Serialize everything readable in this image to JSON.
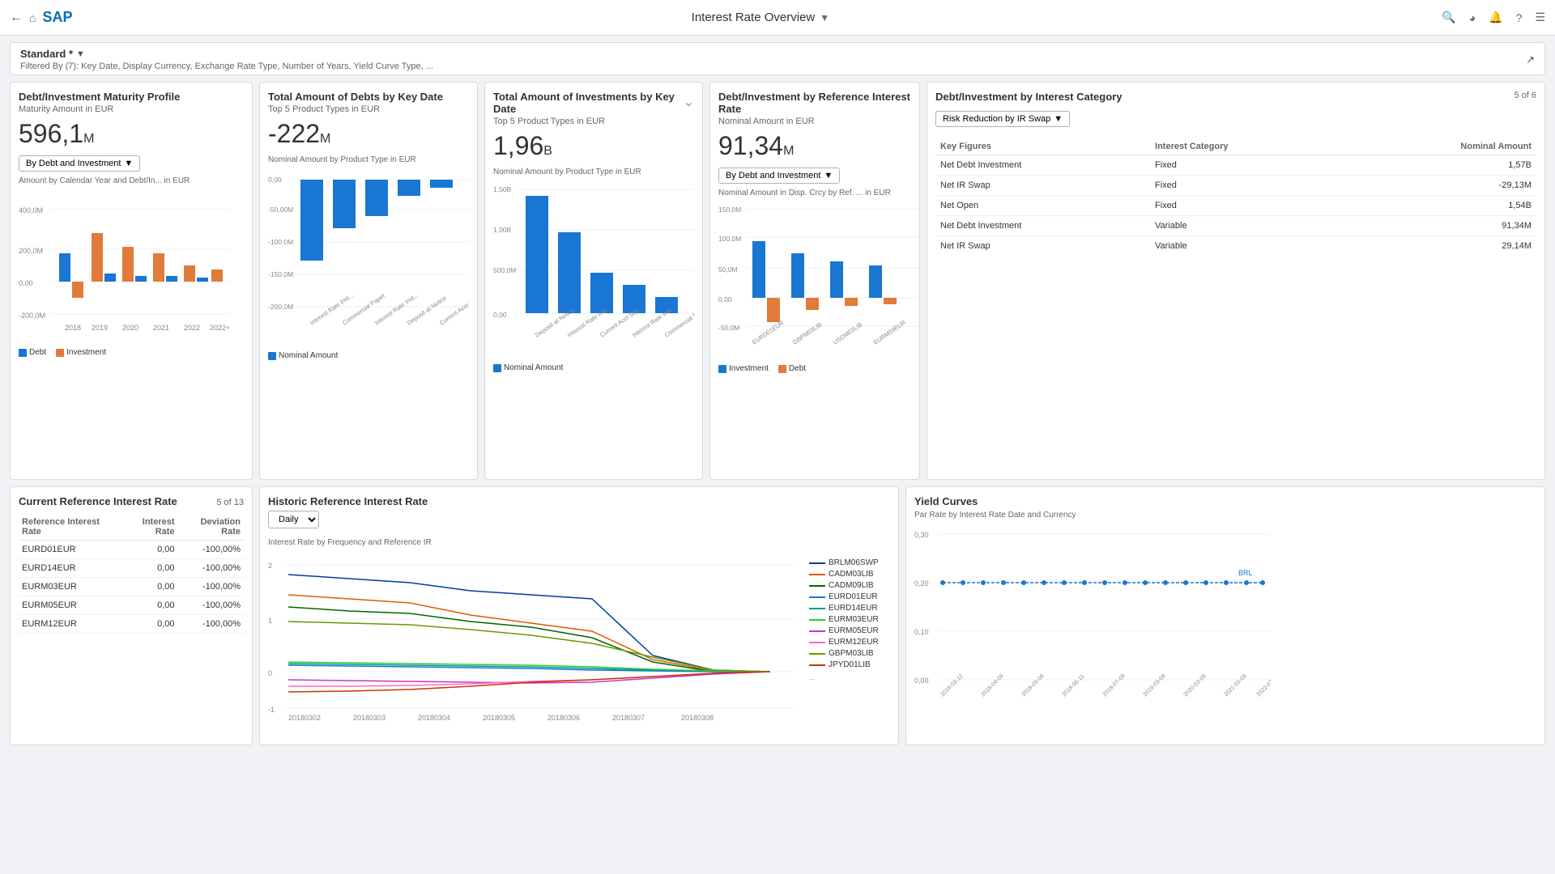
{
  "nav": {
    "title": "Interest Rate Overview",
    "icons": [
      "search",
      "clock",
      "bell",
      "help",
      "menu"
    ]
  },
  "standard": {
    "label": "Standard *",
    "filter_text": "Filtered By (7): Key Date, Display Currency, Exchange Rate Type, Number of Years, Yield Curve Type, ..."
  },
  "card1": {
    "title": "Debt/Investment Maturity Profile",
    "subtitle": "Maturity Amount in EUR",
    "value": "596,1",
    "unit": "M",
    "dropdown_label": "By Debt and Investment",
    "chart_label": "Amount by Calendar Year and Debt/In... in EUR",
    "years": [
      "2018",
      "2019",
      "2020",
      "2021",
      "2022",
      "2022+"
    ],
    "legend_debt": "Debt",
    "legend_investment": "Investment"
  },
  "card2": {
    "title": "Total Amount of Debts by Key Date",
    "subtitle": "Top 5 Product Types in EUR",
    "value": "-222",
    "unit": "M",
    "chart_label": "Nominal Amount by Product Type in EUR",
    "legend": "Nominal Amount"
  },
  "card3": {
    "title": "Total Amount of Investments by Key Date",
    "subtitle": "Top 5 Product Types in EUR",
    "value": "1,96",
    "unit": "B",
    "chart_label": "Nominal Amount by Product Type in EUR",
    "legend": "Nominal Amount"
  },
  "card4": {
    "title": "Debt/Investment by Reference Interest Rate",
    "subtitle": "Nominal Amount in EUR",
    "value": "91,34",
    "unit": "M",
    "chart_label": "Nominal Amount in Disp. Crcy by Ref. ... in EUR",
    "dropdown_label": "By Debt and Investment",
    "x_labels": [
      "EURD01EUR",
      "GBPM03LIB",
      "USDM03LIB",
      "EURM03EUR"
    ],
    "legend_investment": "Investment",
    "legend_debt": "Debt"
  },
  "card5": {
    "title": "Debt/Investment by Interest Category",
    "page": "5 of 6",
    "dropdown_label": "Risk Reduction by IR Swap",
    "table_headers": [
      "Key Figures",
      "Interest Category",
      "Nominal Amount"
    ],
    "rows": [
      {
        "key": "Net Debt Investment",
        "category": "Fixed",
        "amount": "1,57B"
      },
      {
        "key": "Net IR Swap",
        "category": "Fixed",
        "amount": "-29,13M"
      },
      {
        "key": "Net Open",
        "category": "Fixed",
        "amount": "1,54B"
      },
      {
        "key": "Net Debt Investment",
        "category": "Variable",
        "amount": "91,34M"
      },
      {
        "key": "Net IR Swap",
        "category": "Variable",
        "amount": "29,14M"
      }
    ]
  },
  "card_ref": {
    "title": "Current Reference Interest Rate",
    "page": "5 of 13",
    "headers": [
      "Reference Interest Rate",
      "Interest Rate",
      "Deviation Rate"
    ],
    "rows": [
      {
        "ref": "EURD01EUR",
        "rate": "0,00",
        "dev": "-100,00%"
      },
      {
        "ref": "EURD14EUR",
        "rate": "0,00",
        "dev": "-100,00%"
      },
      {
        "ref": "EURM03EUR",
        "rate": "0,00",
        "dev": "-100,00%"
      },
      {
        "ref": "EURM05EUR",
        "rate": "0,00",
        "dev": "-100,00%"
      },
      {
        "ref": "EURM12EUR",
        "rate": "0,00",
        "dev": "-100,00%"
      }
    ]
  },
  "card_hist": {
    "title": "Historic Reference Interest Rate",
    "dropdown_label": "Daily",
    "chart_label": "Interest Rate by Frequency and Reference IR",
    "y_max": 2,
    "y_min": -1,
    "x_labels": [
      "20180302",
      "20180303",
      "20180304",
      "20180305",
      "20180306",
      "20180307",
      "20180308"
    ],
    "legend": [
      "BRLM06SWP",
      "CADM03LIB",
      "CADM09LIB",
      "EURD01EUR",
      "EURD14EUR",
      "EURM03EUR",
      "EURM05EUR",
      "EURM12EUR",
      "GBPM03LIB",
      "JPYD01LIB"
    ]
  },
  "card_yield": {
    "title": "Yield Curves",
    "chart_label": "Par Rate by Interest Rate Date and Currency",
    "legend": "BRL",
    "y_labels": [
      "0,30",
      "0,20",
      "0,10",
      "0,00"
    ]
  }
}
